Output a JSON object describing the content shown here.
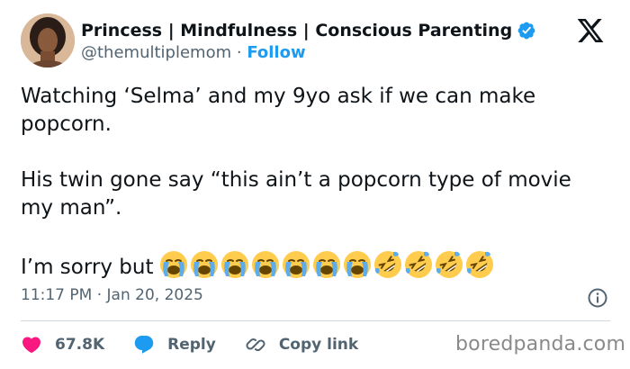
{
  "author": {
    "display_name": "Princess | Mindfulness | Conscious Parenting",
    "handle": "@themultiplemom",
    "separator": "·",
    "follow_label": "Follow",
    "verified_icon": "verified-badge-icon",
    "verified_color": "#1d9bf0"
  },
  "platform_logo": "x-logo-icon",
  "tweet": {
    "paragraphs": [
      "Watching ‘Selma’ and my 9yo ask if we can make popcorn.",
      "His twin gone say “this ain’t a popcorn type of movie my man”.",
      "I’m sorry but"
    ],
    "emojis": [
      "loudly-crying-face",
      "loudly-crying-face",
      "loudly-crying-face",
      "loudly-crying-face",
      "loudly-crying-face",
      "loudly-crying-face",
      "loudly-crying-face",
      "rolling-on-floor-laughing",
      "rolling-on-floor-laughing",
      "rolling-on-floor-laughing",
      "rolling-on-floor-laughing"
    ],
    "timestamp": "11:17 PM · Jan 20, 2025"
  },
  "actions": {
    "like_count": "67.8K",
    "reply_label": "Reply",
    "copy_link_label": "Copy link",
    "like_color": "#f91880",
    "reply_color": "#1d9bf0"
  },
  "watermark": "boredpanda.com"
}
